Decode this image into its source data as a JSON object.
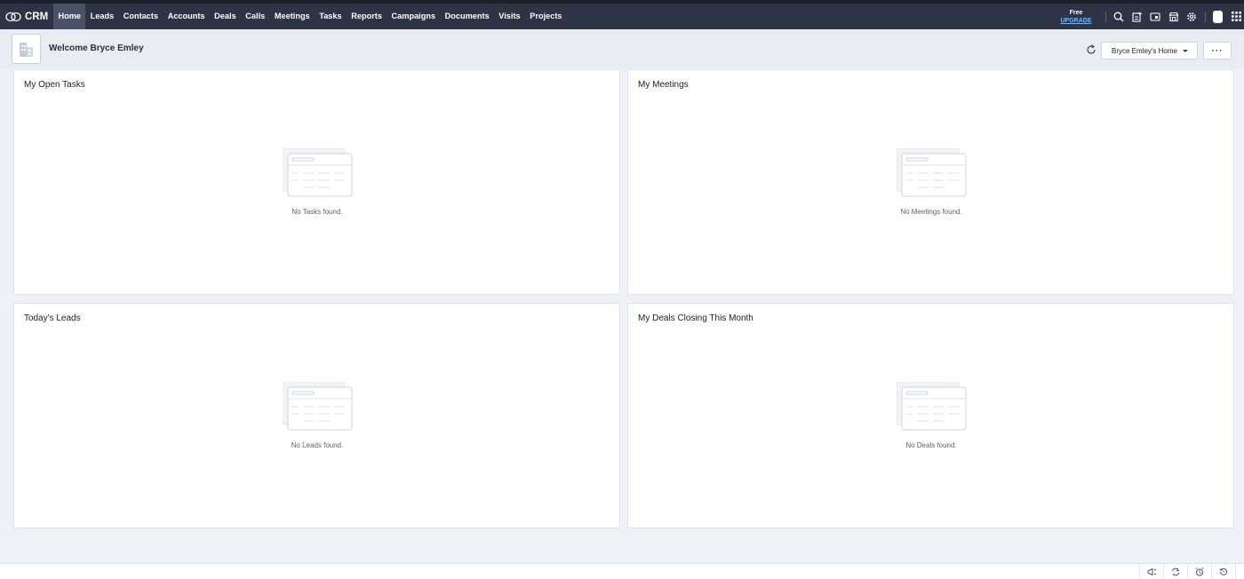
{
  "app": {
    "brand": "CRM"
  },
  "nav": {
    "items": [
      {
        "label": "Home",
        "active": true
      },
      {
        "label": "Leads",
        "active": false
      },
      {
        "label": "Contacts",
        "active": false
      },
      {
        "label": "Accounts",
        "active": false
      },
      {
        "label": "Deals",
        "active": false
      },
      {
        "label": "Calls",
        "active": false
      },
      {
        "label": "Meetings",
        "active": false
      },
      {
        "label": "Tasks",
        "active": false
      },
      {
        "label": "Reports",
        "active": false
      },
      {
        "label": "Campaigns",
        "active": false
      },
      {
        "label": "Documents",
        "active": false
      },
      {
        "label": "Visits",
        "active": false
      },
      {
        "label": "Projects",
        "active": false
      }
    ]
  },
  "upgrade": {
    "free_label": "Free",
    "upgrade_label": "UPGRADE"
  },
  "top_icons": [
    "search-icon",
    "create-record-icon",
    "calendar-icon",
    "marketplace-icon",
    "settings-icon",
    "profile-avatar",
    "apps-grid-icon"
  ],
  "welcome": {
    "text": "Welcome Bryce Emley",
    "home_selector": "Bryce Emley's Home",
    "more_label": "···"
  },
  "cards": [
    {
      "title": "My Open Tasks",
      "empty": "No Tasks found."
    },
    {
      "title": "My Meetings",
      "empty": "No Meetings found."
    },
    {
      "title": "Today's Leads",
      "empty": "No Leads found."
    },
    {
      "title": "My Deals Closing This Month",
      "empty": "No Deals found."
    }
  ],
  "bottom_icons": [
    "announcement-icon",
    "sync-icon",
    "alarm-icon",
    "history-icon",
    "notes-icon"
  ],
  "colors": {
    "topbar": "#2d3446",
    "active_tab": "#4a5266",
    "upgrade_link": "#6fb7ff",
    "page_bg": "#eef1f5"
  }
}
